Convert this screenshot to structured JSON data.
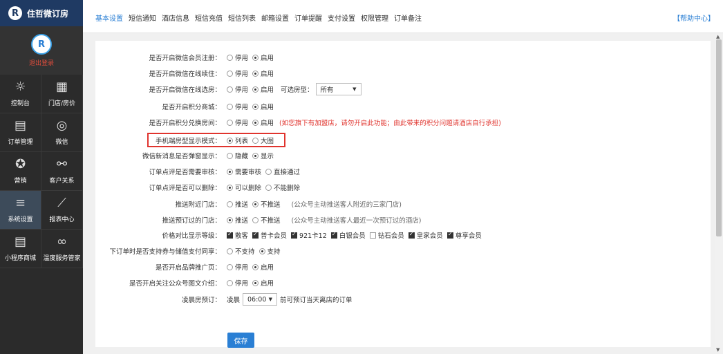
{
  "brand": {
    "name": "住哲微订房",
    "logo": "R"
  },
  "user": {
    "logout_label": "退出登录"
  },
  "sidebar": {
    "items": [
      {
        "icon": "☼",
        "label": "控制台"
      },
      {
        "icon": "▦",
        "label": "门店/房价"
      },
      {
        "icon": "▤",
        "label": "订单管理"
      },
      {
        "icon": "◎",
        "label": "微信"
      },
      {
        "icon": "✪",
        "label": "营销"
      },
      {
        "icon": "⚯",
        "label": "客户关系"
      },
      {
        "icon": "≡",
        "label": "系统设置"
      },
      {
        "icon": "⟋",
        "label": "报表中心"
      },
      {
        "icon": "▤",
        "label": "小程序商城"
      },
      {
        "icon": "∞",
        "label": "温度服务管家"
      }
    ]
  },
  "nav": {
    "tabs": [
      "基本设置",
      "短信通知",
      "酒店信息",
      "短信充值",
      "短信列表",
      "邮箱设置",
      "订单提醒",
      "支付设置",
      "权限管理",
      "订单备注"
    ],
    "help": "【帮助中心】"
  },
  "settings": {
    "r1": {
      "label": "是否开启微信会员注册：",
      "a": "停用",
      "b": "启用"
    },
    "r2": {
      "label": "是否开启微信在线续住：",
      "a": "停用",
      "b": "启用"
    },
    "r3": {
      "label": "是否开启微信在线选房：",
      "a": "停用",
      "b": "启用",
      "extra_label": "可选房型：",
      "select": "所有"
    },
    "r4": {
      "label": "是否开启积分商城：",
      "a": "停用",
      "b": "启用"
    },
    "r5": {
      "label": "是否开启积分兑换房间：",
      "a": "停用",
      "b": "启用",
      "note": "(如您旗下有加盟店，请勿开启此功能；由此带来的积分问题请酒店自行承担)"
    },
    "r6": {
      "label": "手机端房型显示模式：",
      "a": "列表",
      "b": "大图"
    },
    "r7": {
      "label": "微信新消息是否弹窗显示：",
      "a": "隐藏",
      "b": "显示"
    },
    "r8": {
      "label": "订单点评是否需要审核：",
      "a": "需要审核",
      "b": "直接通过"
    },
    "r9": {
      "label": "订单点评是否可以删除：",
      "a": "可以删除",
      "b": "不能删除"
    },
    "r10": {
      "label": "推送附近门店：",
      "a": "推送",
      "b": "不推送",
      "note": "(公众号主动推送客人附近的三家门店)"
    },
    "r11": {
      "label": "推送预订过的门店：",
      "a": "推送",
      "b": "不推送",
      "note": "(公众号主动推送客人最近一次预订过的酒店)"
    },
    "r12": {
      "label": "价格对比显示等级：",
      "levels": [
        "散客",
        "普卡会员",
        "921卡12",
        "白银会员",
        "钻石会员",
        "皇家会员",
        "尊享会员"
      ]
    },
    "r13": {
      "label": "下订单时是否支持券与储值支付同享：",
      "a": "不支持",
      "b": "支持"
    },
    "r14": {
      "label": "是否开启品牌推广页：",
      "a": "停用",
      "b": "启用"
    },
    "r15": {
      "label": "是否开启关注公众号图文介绍：",
      "a": "停用",
      "b": "启用"
    },
    "r16": {
      "label": "凌晨房预订：",
      "prefix": "凌晨",
      "time": "06:00",
      "suffix": "前可预订当天离店的订单"
    }
  },
  "save_label": "保存",
  "colors": {
    "accent": "#2a7fd4",
    "warning": "#e0342e",
    "sidebar": "#2b2b2b",
    "brand_bar": "#1f3a63"
  }
}
